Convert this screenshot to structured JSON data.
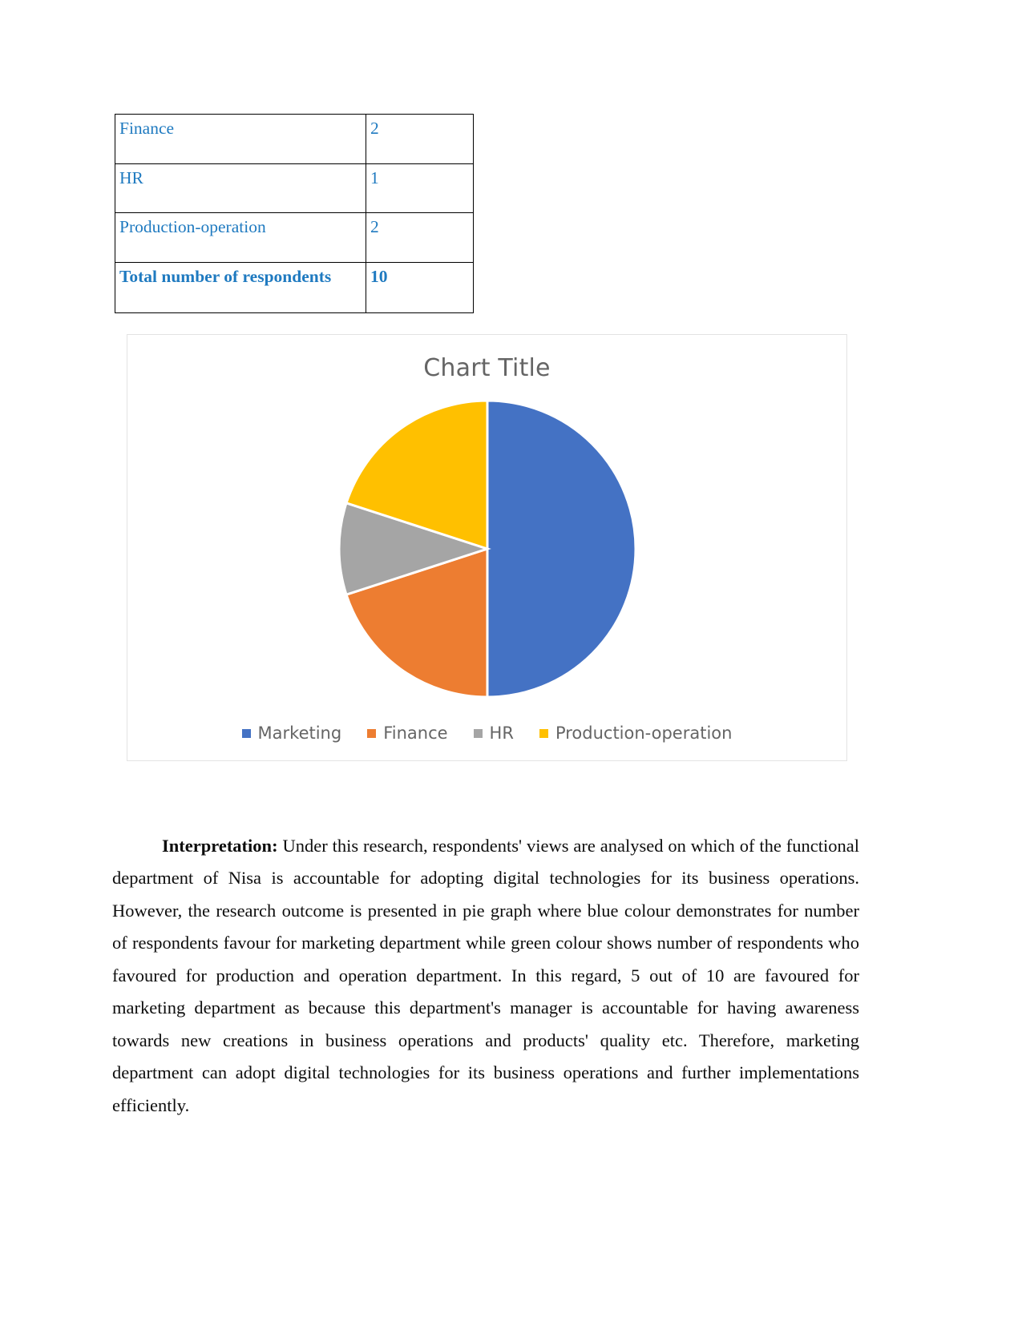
{
  "table": {
    "rows": [
      {
        "label": "Finance",
        "value": "2",
        "bold": false
      },
      {
        "label": "HR",
        "value": "1",
        "bold": false
      },
      {
        "label": "Production-operation",
        "value": "2",
        "bold": false
      },
      {
        "label": "Total number of respondents",
        "value": "10",
        "bold": true
      }
    ]
  },
  "chart": {
    "title": "Chart Title",
    "legend": [
      {
        "label": "Marketing",
        "color": "#4472C4"
      },
      {
        "label": "Finance",
        "color": "#ED7D31"
      },
      {
        "label": "HR",
        "color": "#A5A5A5"
      },
      {
        "label": "Production-operation",
        "color": "#FFC000"
      }
    ]
  },
  "chart_data": {
    "type": "pie",
    "title": "Chart Title",
    "categories": [
      "Marketing",
      "Finance",
      "HR",
      "Production-operation"
    ],
    "values": [
      5,
      2,
      1,
      2
    ],
    "percentages": [
      50,
      20,
      10,
      20
    ],
    "colors": [
      "#4472C4",
      "#ED7D31",
      "#A5A5A5",
      "#FFC000"
    ],
    "total": 10,
    "units": "number of respondents",
    "legend_position": "bottom",
    "start_angle_deg": 0,
    "direction": "clockwise",
    "data_labels": false,
    "grid": false
  },
  "interpretation": {
    "lead": "Interpretation:",
    "body": " Under this research, respondents' views are analysed on which of the functional department of Nisa is accountable for adopting digital technologies for its business operations. However, the research outcome is presented in pie graph where blue colour demonstrates for number of respondents favour for marketing department while green colour shows number of respondents who favoured for production and operation department. In this regard, 5 out of 10 are favoured for marketing department as because this department's manager is accountable for having awareness towards new creations in business operations and products' quality etc. Therefore, marketing department can adopt digital technologies for its business operations and further implementations efficiently."
  }
}
